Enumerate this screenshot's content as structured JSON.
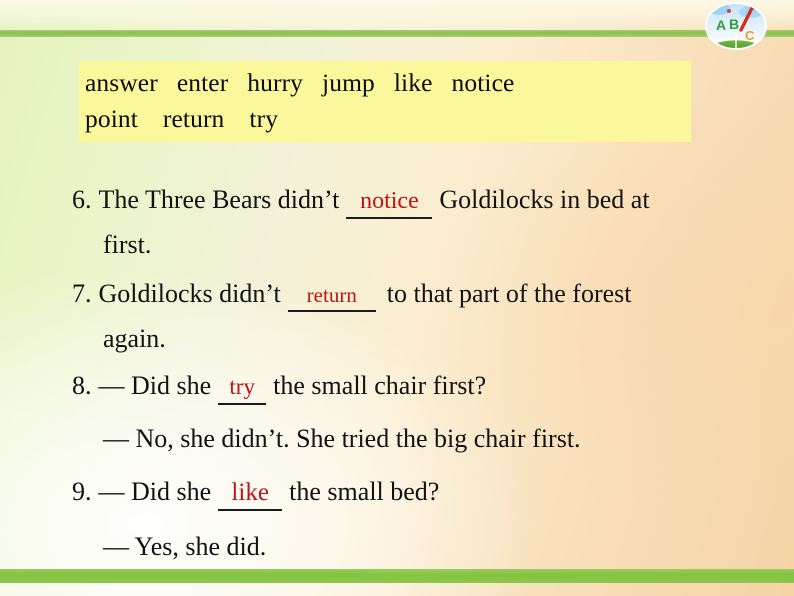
{
  "slide": {
    "background_left_color": "#e4f2bd",
    "background_right_color": "#f6d4a6",
    "rule_color": "#8cc64a",
    "answer_color": "#c01414"
  },
  "logo": {
    "name": "abc-logo",
    "letters": [
      "A",
      "B",
      "C"
    ],
    "letter_colors": [
      "#2f9e3f",
      "#2f9e3f",
      "#e8a020"
    ],
    "accent_color": "#d62b1f",
    "sky_color": "#a9d7f2",
    "grass_color": "#5fa83c"
  },
  "wordbank": {
    "background_color": "#faf89a",
    "row1": [
      "answer",
      "enter",
      "hurry",
      "jump",
      "like",
      "notice"
    ],
    "row2": [
      "point",
      "return",
      "try"
    ]
  },
  "exercise": {
    "items": [
      {
        "number": "6.",
        "before": "The Three Bears didn’t",
        "answer": "notice",
        "after": "Goldilocks in bed at",
        "continuation": "first."
      },
      {
        "number": "7.",
        "before": "Goldilocks didn’t",
        "answer": "return",
        "after": "to that part of the forest",
        "continuation": "again."
      },
      {
        "number": "8.",
        "before": "— Did she",
        "answer": "try",
        "after": "the small chair first?",
        "continuation": "— No, she didn’t. She tried the big chair first."
      },
      {
        "number": "9.",
        "before": "— Did she",
        "answer": "like",
        "after": "the small bed?",
        "continuation": "— Yes, she did."
      }
    ]
  }
}
